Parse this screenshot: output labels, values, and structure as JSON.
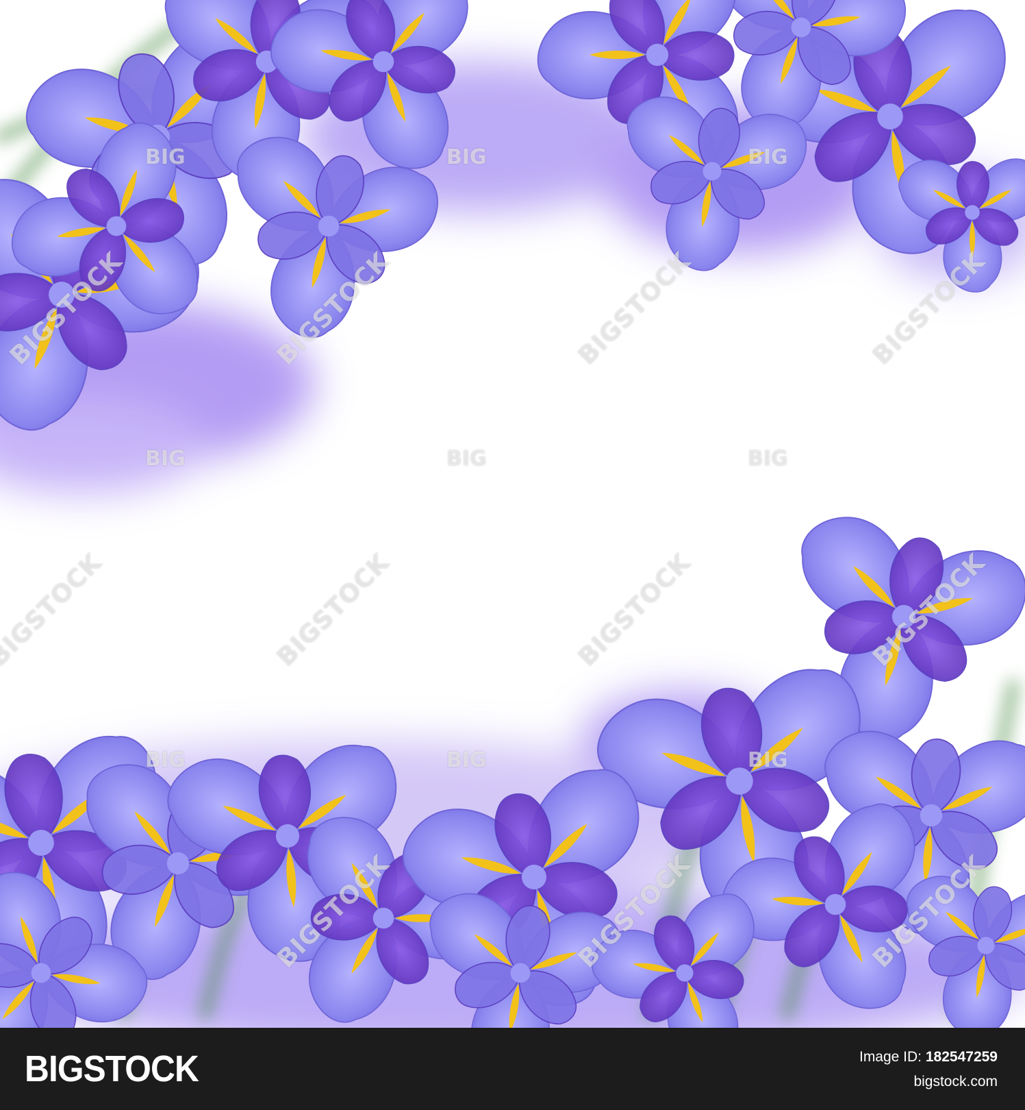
{
  "image": {
    "subject": "purple iris flowers",
    "colors": {
      "petal_light": "#8a86ee",
      "petal_dark": "#6b3fd0",
      "fall_yellow": "#f2c21a",
      "stem_green": "#4f8f4a",
      "background": "#ffffff",
      "footer": "#1c1c1c"
    }
  },
  "watermarks": {
    "short": "BIG",
    "long": "BIGSTOCK"
  },
  "footer": {
    "logo": "BIGSTOCK",
    "image_id_label": "Image ID:",
    "image_id": "182547259",
    "site": "bigstock.com"
  }
}
